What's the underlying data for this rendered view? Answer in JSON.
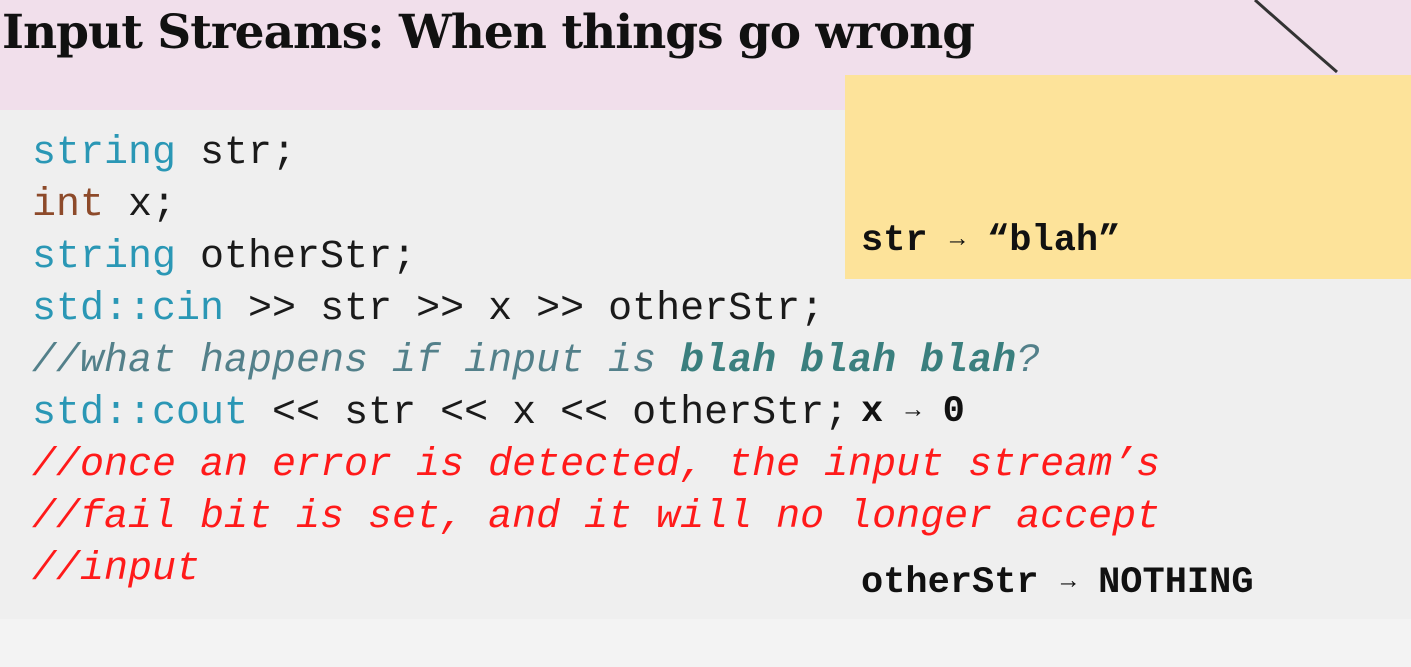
{
  "slide": {
    "title": "Input Streams: When things go wrong"
  },
  "code": {
    "l1": {
      "type": "string",
      "rest": " str;"
    },
    "l2": {
      "type": "int",
      "rest": " x;"
    },
    "l3": {
      "type": "string",
      "rest": " otherStr;"
    },
    "l4": {
      "ns": "std::",
      "obj": "cin",
      "rest": " >> str >> x >> otherStr;"
    },
    "l5": {
      "pre": "//what happens if input is ",
      "emph": "blah blah blah",
      "post": "?"
    },
    "l6": {
      "ns": "std::",
      "obj": "cout",
      "rest": " << str << x << otherStr;"
    },
    "l7": "//once an error is detected, the input stream’s",
    "l8": "//fail bit is set, and it will no longer accept",
    "l9": "//input"
  },
  "callout": {
    "rows": [
      {
        "name": "str",
        "arrow": "→",
        "value": "“blah”"
      },
      {
        "name": "x",
        "arrow": "→",
        "value": "0"
      },
      {
        "name": "otherStr",
        "arrow": "→",
        "value": "NOTHING"
      }
    ]
  },
  "colors": {
    "title_band": "#f1dfeb",
    "code_background": "#efefef",
    "callout_background": "#fde39a",
    "type_keyword": "#2a97b5",
    "int_keyword": "#8d4a2a",
    "comment": "#53808a",
    "comment_emphasis": "#3a7f7e",
    "error_comment": "#ff1a1a"
  }
}
